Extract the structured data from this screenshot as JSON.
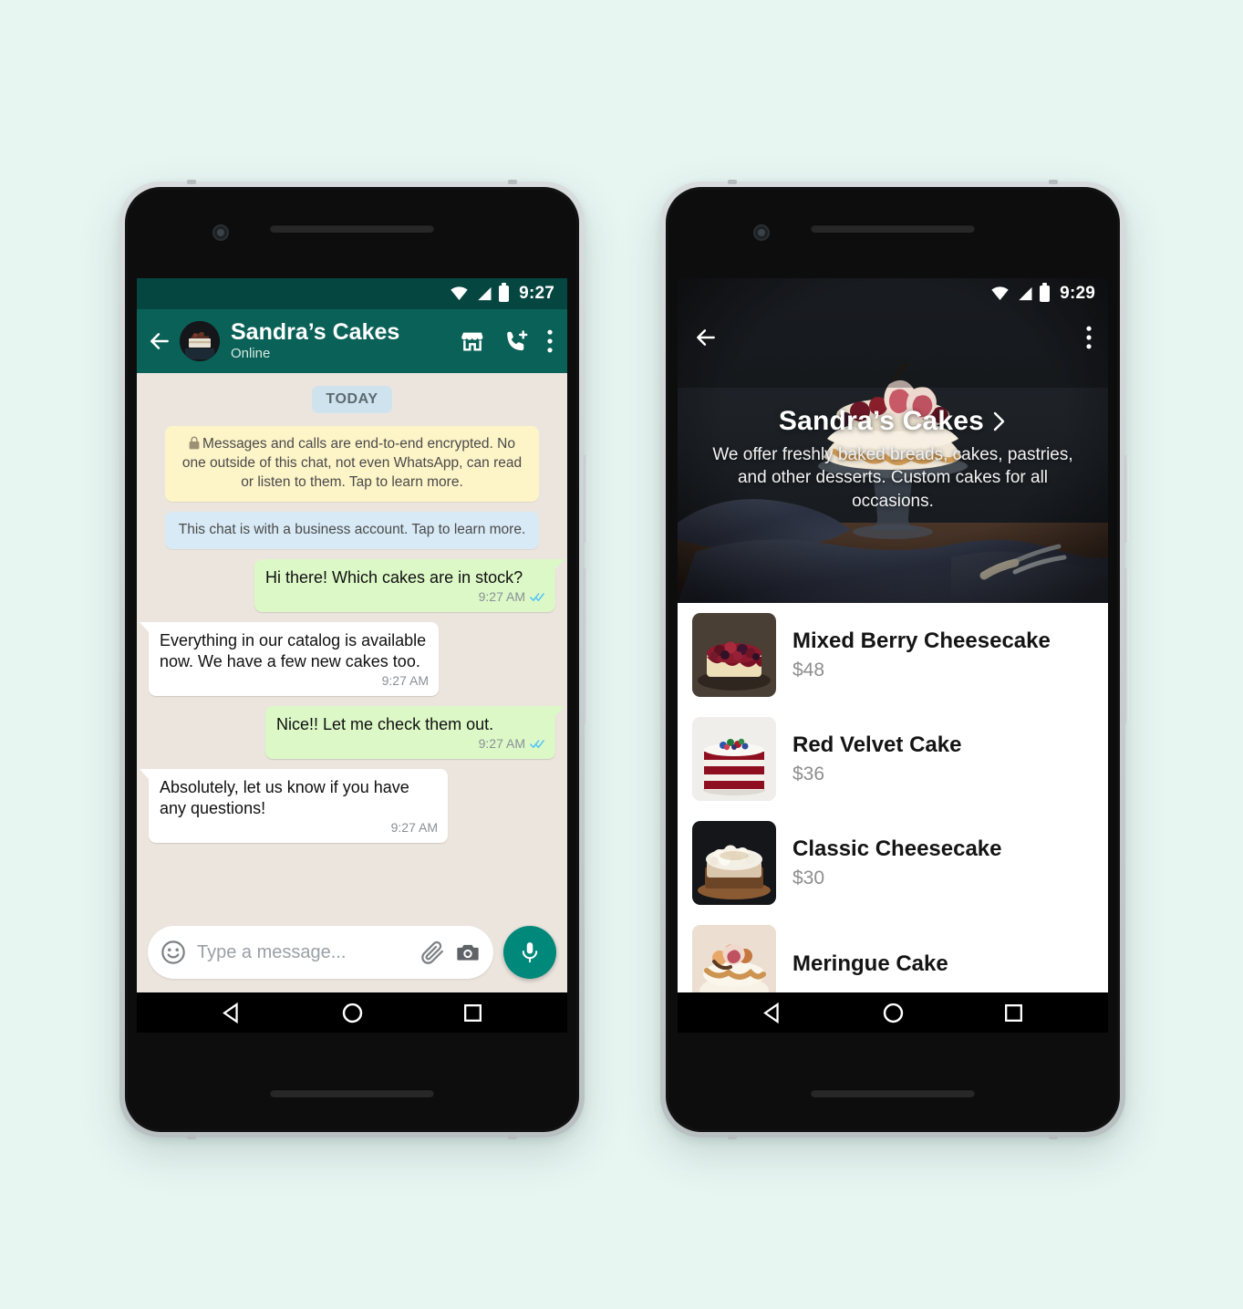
{
  "canvas": {
    "background": "#e8f6f2"
  },
  "phone1": {
    "status_bar": {
      "time": "9:27",
      "icons": [
        "wifi-icon",
        "signal-icon",
        "battery-icon"
      ]
    },
    "header": {
      "back_icon": "back-arrow-icon",
      "avatar": "contact-avatar",
      "name": "Sandra’s Cakes",
      "status": "Online",
      "icons": [
        "storefront-icon",
        "call-add-icon",
        "overflow-menu-icon"
      ],
      "color": "#0a6157"
    },
    "chat": {
      "background": "#ece5de",
      "day_divider": "TODAY",
      "system_messages": [
        {
          "kind": "encryption",
          "lock": true,
          "text": "Messages and calls are end-to-end encrypted. No one outside of this chat, not even WhatsApp, can read or listen to them. Tap to learn more.",
          "color": "#fdf4c8"
        },
        {
          "kind": "business",
          "lock": false,
          "text": "This chat is with a business account. Tap to learn more.",
          "color": "#d7eaf5"
        }
      ],
      "messages": [
        {
          "dir": "out",
          "text": "Hi there! Which cakes are in stock?",
          "time": "9:27 AM",
          "ticks": "read",
          "width": "w1"
        },
        {
          "dir": "in",
          "text": "Everything in our catalog is available now. We have a few new cakes too.",
          "time": "9:27 AM",
          "ticks": "none",
          "width": "w2"
        },
        {
          "dir": "out",
          "text": "Nice!! Let me check them out.",
          "time": "9:27 AM",
          "ticks": "read",
          "width": "w3"
        },
        {
          "dir": "in",
          "text": "Absolutely, let us know if you have any questions!",
          "time": "9:27 AM",
          "ticks": "none",
          "width": "w4"
        }
      ]
    },
    "input_bar": {
      "placeholder": "Type a message...",
      "emoji_icon": "emoji-smiley-icon",
      "attach_icon": "paperclip-icon",
      "camera_icon": "camera-icon",
      "mic_icon": "microphone-icon",
      "mic_color": "#00897b"
    },
    "nav_bar": {
      "back": "nav-back-triangle",
      "home": "nav-home-circle",
      "recents": "nav-recents-square"
    }
  },
  "phone2": {
    "status_bar": {
      "time": "9:29",
      "icons": [
        "wifi-icon",
        "signal-icon",
        "battery-icon"
      ]
    },
    "top_bar": {
      "back_icon": "back-arrow-icon",
      "overflow_icon": "overflow-menu-icon"
    },
    "hero": {
      "title": "Sandra’s Cakes",
      "chevron": "chevron-right-icon",
      "description": "We offer freshly baked breads, cakes, pastries, and other desserts. Custom cakes for all occasions."
    },
    "catalog": [
      {
        "name": "Mixed Berry Cheesecake",
        "price": "$48",
        "thumb": "mixed-berry-cheesecake-thumb"
      },
      {
        "name": "Red Velvet Cake",
        "price": "$36",
        "thumb": "red-velvet-cake-thumb"
      },
      {
        "name": "Classic Cheesecake",
        "price": "$30",
        "thumb": "classic-cheesecake-thumb"
      },
      {
        "name": "Meringue Cake",
        "price": "",
        "thumb": "meringue-cake-thumb"
      }
    ],
    "nav_bar": {
      "back": "nav-back-triangle",
      "home": "nav-home-circle",
      "recents": "nav-recents-square"
    }
  }
}
